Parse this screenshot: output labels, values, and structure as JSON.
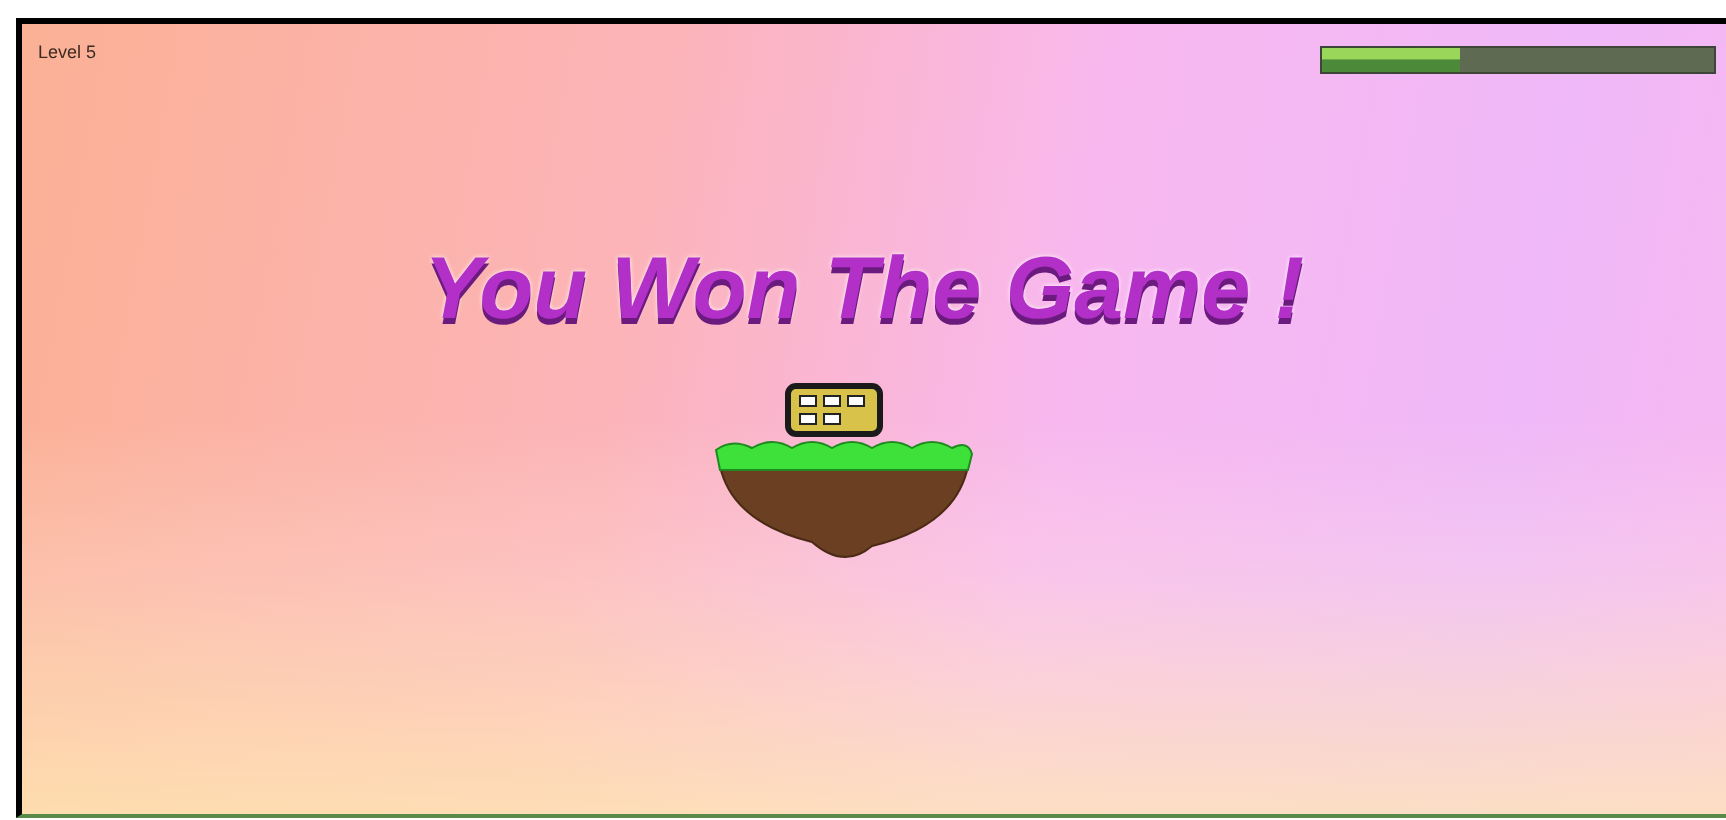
{
  "hud": {
    "level_label": "Level 5",
    "progress": {
      "level": 0.35
    }
  },
  "message": {
    "title": "You Won The Game !"
  }
}
